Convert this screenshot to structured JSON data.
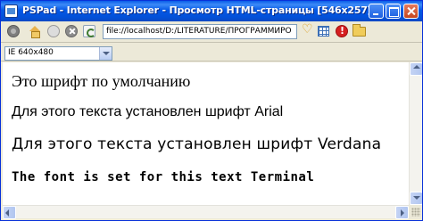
{
  "window": {
    "title": "PSPad - Internet Explorer - Просмотр HTML-страницы   [546x257]"
  },
  "toolbar": {
    "address": "file://localhost/D:/LITERATURE/ПРОГРАММИРО",
    "icons": [
      "back-icon",
      "home-icon",
      "forward-icon",
      "stop-icon",
      "refresh-icon",
      "favorite-icon",
      "grid-icon",
      "error-icon",
      "folder-icon"
    ]
  },
  "size_selector": {
    "value": "IE 640x480"
  },
  "content": {
    "lines": [
      "Это шрифт по умолчанию",
      "Для этого текста установлен шрифт Arial",
      "Для этого текста установлен шрифт Verdana",
      "The font is set for this text Terminal"
    ]
  },
  "colors": {
    "titlebar": "#0458e6",
    "window_face": "#ece9d8",
    "content_bg": "#ffffff",
    "close_button": "#c8461f"
  }
}
